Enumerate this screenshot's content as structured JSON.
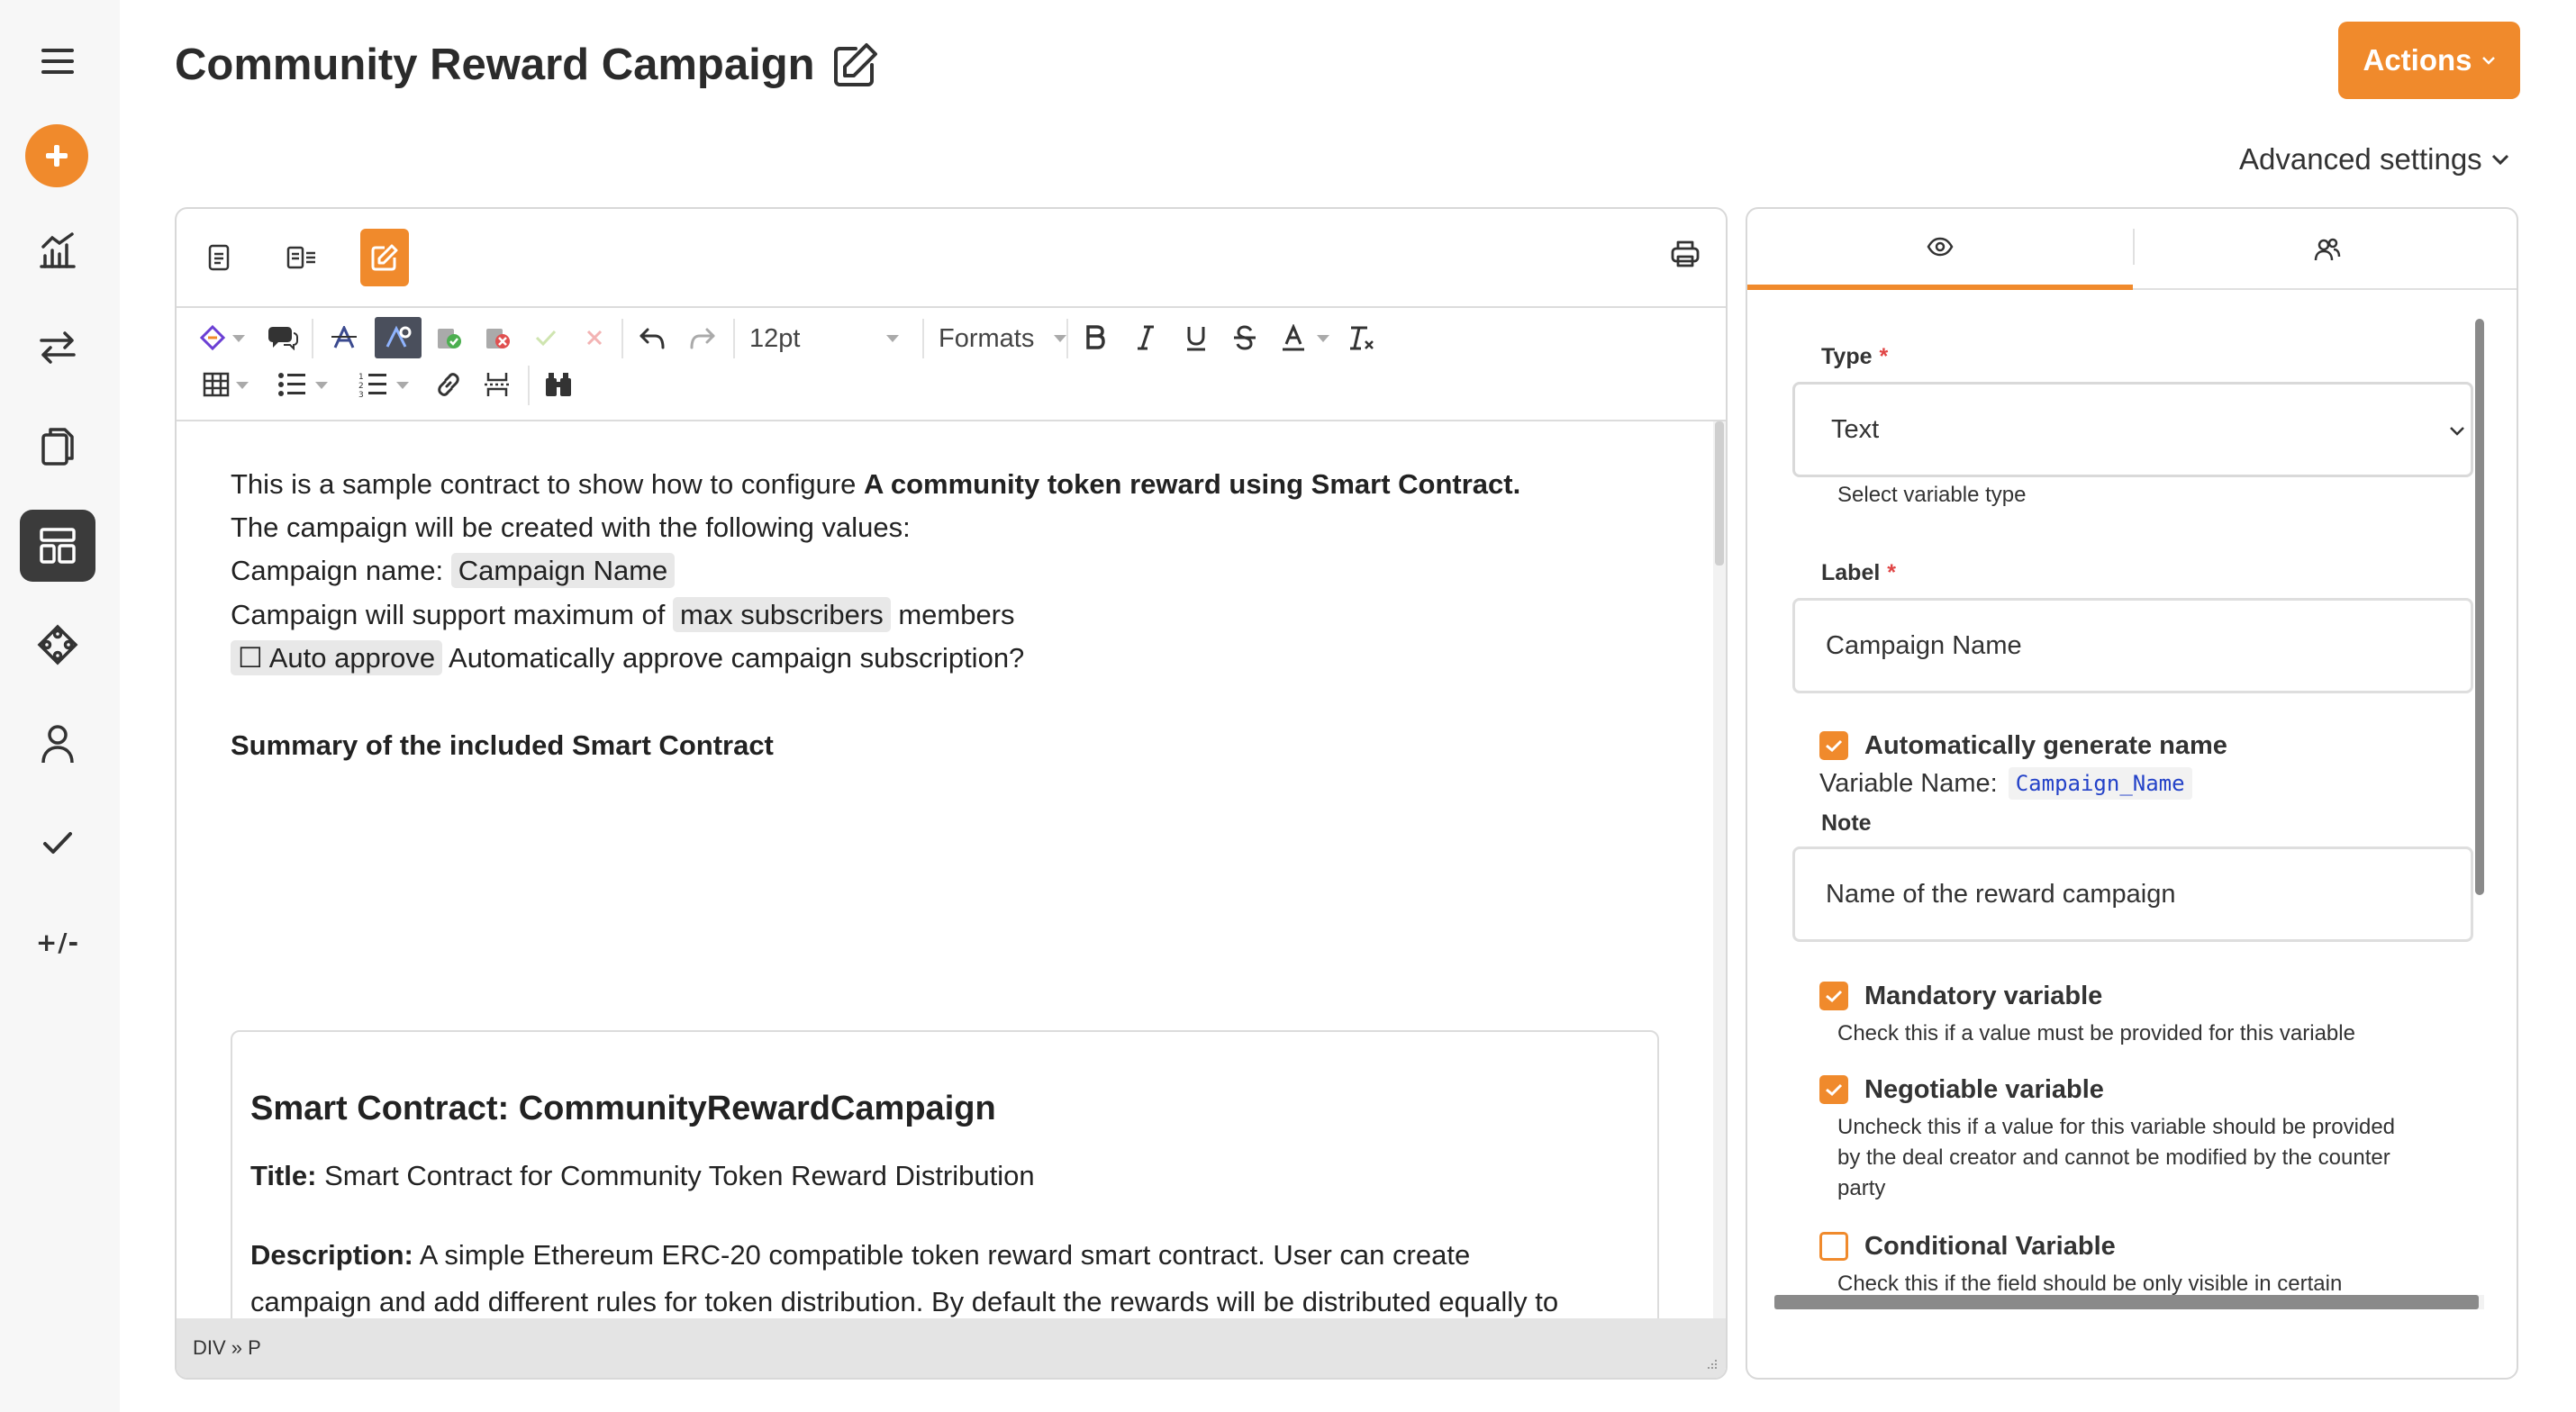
{
  "sidebar": {
    "items": [
      {
        "name": "menu-icon"
      },
      {
        "name": "add-icon"
      },
      {
        "name": "analytics-icon"
      },
      {
        "name": "transfer-icon"
      },
      {
        "name": "documents-icon"
      },
      {
        "name": "dashboard-icon",
        "active": true
      },
      {
        "name": "integrations-icon"
      },
      {
        "name": "user-icon"
      },
      {
        "name": "check-icon"
      },
      {
        "name": "plus-minus",
        "text": "+/-"
      }
    ]
  },
  "header": {
    "title": "Community Reward Campaign",
    "actions_label": "Actions",
    "advanced_settings_label": "Advanced settings"
  },
  "editor": {
    "toolbar": {
      "font_size": "12pt",
      "formats_label": "Formats"
    },
    "content": {
      "p1_text": "This is a sample contract to show how to configure ",
      "p1_bold": "A community token reward using Smart Contract.",
      "p2": "The campaign will be created with the following values:",
      "p3_label": "Campaign name: ",
      "p3_chip": "Campaign Name",
      "p4_before": "Campaign will support maximum of ",
      "p4_chip": "max subscribers",
      "p4_after": " members",
      "p5_chip": "☐ Auto approve",
      "p5_after": " Automatically approve campaign subscription?",
      "summary_heading": "Summary of the included Smart Contract",
      "sc_heading": "Smart Contract: CommunityRewardCampaign",
      "title_label": "Title:",
      "title_value": " Smart Contract for Community Token Reward Distribution",
      "desc_label": "Description:",
      "desc_value": " A simple Ethereum ERC-20 compatible token reward smart contract. User can create",
      "desc_line2": "campaign and add different rules for token distribution. By default the rewards will be distributed equally to"
    },
    "statusbar": "DIV » P"
  },
  "panel": {
    "tabs": [
      {
        "name": "preview-tab",
        "icon": "eye-icon",
        "active": true
      },
      {
        "name": "participants-tab",
        "icon": "users-icon",
        "active": false
      }
    ],
    "type_label": "Type",
    "type_value": "Text",
    "type_help": "Select variable type",
    "label_label": "Label",
    "label_value": "Campaign Name",
    "auto_name_label": "Automatically generate name",
    "auto_name_checked": true,
    "variable_name_label": "Variable Name:",
    "variable_name_value": "Campaign_Name",
    "note_label": "Note",
    "note_value": "Name of the  reward campaign",
    "mandatory_label": "Mandatory variable",
    "mandatory_checked": true,
    "mandatory_help": "Check this if a value must be provided for this variable",
    "negotiable_label": "Negotiable variable",
    "negotiable_checked": true,
    "negotiable_help_1": "Uncheck this if a value for this variable should be provided",
    "negotiable_help_2": "by the deal creator and cannot be modified by the counter",
    "negotiable_help_3": "party",
    "conditional_label": "Conditional Variable",
    "conditional_checked": false,
    "conditional_help": "Check this if the field should be only visible in certain"
  },
  "colors": {
    "accent": "#f08a2c",
    "sidebar_active": "#3b3b3b",
    "required": "#e04545",
    "code_text": "#2442c8"
  }
}
